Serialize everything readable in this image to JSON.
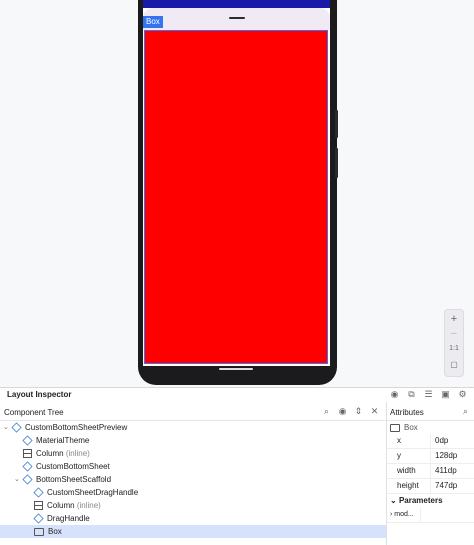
{
  "preview": {
    "selected_tag": "Box",
    "zoom": {
      "zoom_in": "+",
      "zoom_out": "−",
      "actual": "1:1"
    },
    "colors": {
      "content_box": "#ff0000",
      "selection_border": "#4a6cf0",
      "tag_bg": "#3574f0"
    }
  },
  "inspector": {
    "title": "Layout Inspector",
    "header_icons": [
      "eye-icon",
      "snapshot-icon",
      "tree-settings-icon",
      "layout-icon",
      "gear-icon"
    ]
  },
  "component_tree": {
    "label": "Component Tree",
    "icons": [
      "search-icon",
      "visibility-icon",
      "expand-icon",
      "collapse-icon"
    ],
    "items": [
      {
        "label": "CustomBottomSheetPreview",
        "hint": "",
        "icon": "compose-icon",
        "expanded": true
      },
      {
        "label": "MaterialTheme",
        "hint": "",
        "icon": "compose-icon"
      },
      {
        "label": "Column",
        "hint": "(inline)",
        "icon": "column-icon"
      },
      {
        "label": "CustomBottomSheet",
        "hint": "",
        "icon": "compose-icon"
      },
      {
        "label": "BottomSheetScaffold",
        "hint": "",
        "icon": "compose-icon",
        "expanded": true
      },
      {
        "label": "CustomSheetDragHandle",
        "hint": "",
        "icon": "compose-icon"
      },
      {
        "label": "Column",
        "hint": "(inline)",
        "icon": "column-icon"
      },
      {
        "label": "DragHandle",
        "hint": "",
        "icon": "compose-icon"
      },
      {
        "label": "Box",
        "hint": "",
        "icon": "box-icon",
        "selected": true
      }
    ]
  },
  "attributes": {
    "label": "Attributes",
    "selected": "Box",
    "rows": [
      {
        "key": "x",
        "value": "0dp"
      },
      {
        "key": "y",
        "value": "128dp"
      },
      {
        "key": "width",
        "value": "411dp"
      },
      {
        "key": "height",
        "value": "747dp"
      }
    ],
    "parameters_label": "Parameters",
    "modifier_label": "mod..."
  }
}
